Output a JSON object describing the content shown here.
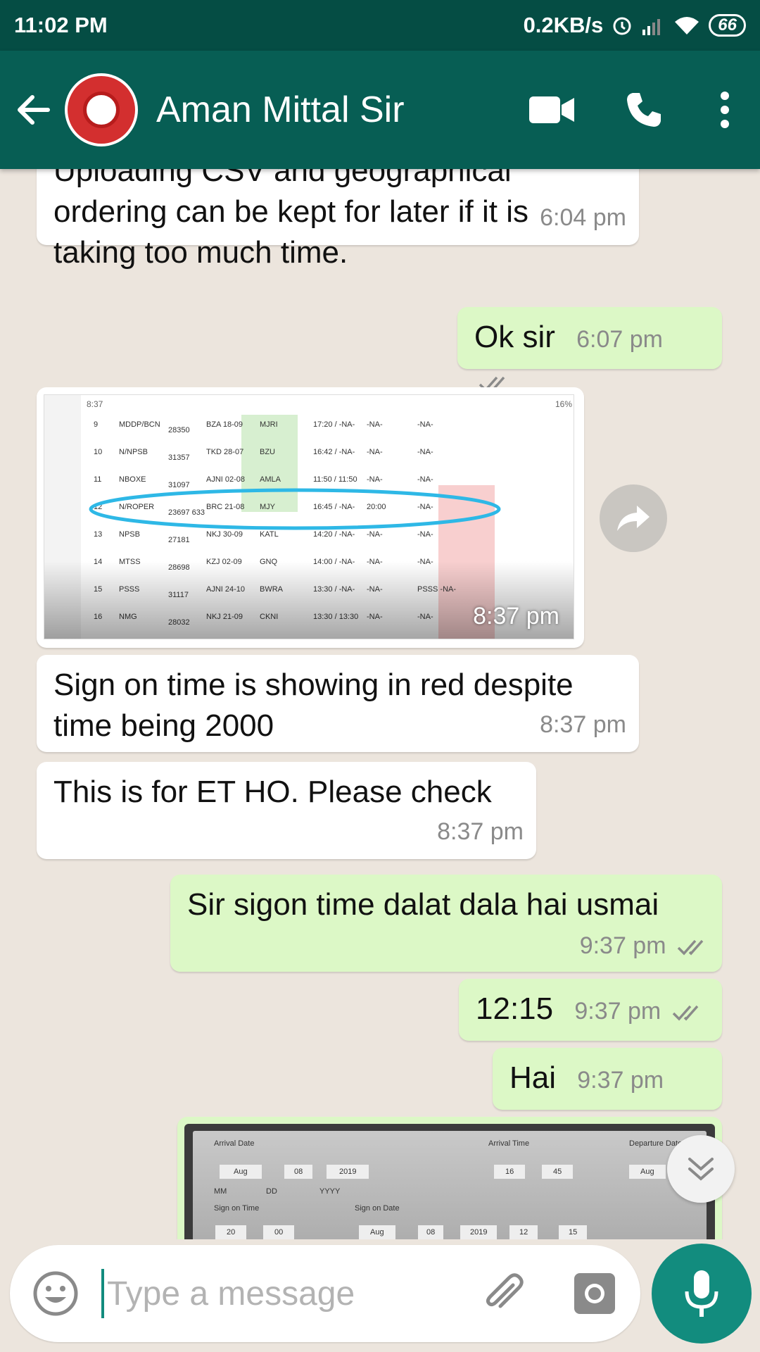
{
  "status_bar": {
    "time": "11:02 PM",
    "speed": "0.2KB/s",
    "battery": "66"
  },
  "app_bar": {
    "contact_name": "Aman Mittal Sir",
    "icons": [
      "back-arrow-icon",
      "video-call-icon",
      "voice-call-icon",
      "more-vert-icon"
    ]
  },
  "messages": [
    {
      "dir": "in",
      "text": "Uploading CSV and geographical ordering can be kept for later if it is taking too much time.",
      "time": "6:04 pm"
    },
    {
      "dir": "out",
      "text": "Ok sir",
      "time": "6:07 pm"
    },
    {
      "dir": "in",
      "type": "image",
      "time": "8:37 pm"
    },
    {
      "dir": "in",
      "text": "Sign on time is showing in red despite time being 2000",
      "time": "8:37 pm"
    },
    {
      "dir": "in",
      "text": "This is for ET HO. Please check",
      "time": "8:37 pm"
    },
    {
      "dir": "out",
      "text": "Sir sigon time dalat dala hai usmai",
      "time": "9:37 pm"
    },
    {
      "dir": "out",
      "text": "12:15",
      "time": "9:37 pm"
    },
    {
      "dir": "out",
      "text": "Hai",
      "time": "9:37 pm"
    },
    {
      "dir": "out",
      "type": "image"
    }
  ],
  "shared_image_1": {
    "status_time": "8:37",
    "battery": "16%",
    "rows": [
      [
        "9",
        "MDDP/BCN",
        "28350",
        "BZA 18-09",
        "MJRI",
        "17:20 / -NA-",
        "-NA-",
        "-NA-"
      ],
      [
        "10",
        "N/NPSB",
        "31357",
        "TKD 28-07",
        "BZU",
        "16:42 / -NA-",
        "-NA-",
        "-NA-"
      ],
      [
        "11",
        "NBOXE",
        "31097",
        "AJNI 02-08",
        "AMLA",
        "11:50 / 11:50",
        "-NA-",
        "-NA-"
      ],
      [
        "12",
        "N/ROPER",
        "23697 633",
        "BRC 21-08",
        "MJY",
        "16:45 / -NA-",
        "20:00",
        "-NA-"
      ],
      [
        "13",
        "NPSB",
        "27181",
        "NKJ 30-09",
        "KATL",
        "14:20 / -NA-",
        "-NA-",
        "-NA-"
      ],
      [
        "14",
        "MTSS",
        "28698",
        "KZJ 02-09",
        "GNQ",
        "14:00 / -NA-",
        "-NA-",
        "-NA-"
      ],
      [
        "15",
        "PSSS",
        "31117",
        "AJNI 24-10",
        "BWRA",
        "13:30 / -NA-",
        "-NA-",
        "PSSS -NA-"
      ],
      [
        "16",
        "NMG",
        "28032",
        "NKJ 21-09",
        "CKNI",
        "13:30 / 13:30",
        "-NA-",
        "-NA-"
      ]
    ]
  },
  "shared_image_2": {
    "labels": {
      "arrival_date": "Arrival Date",
      "arrival_time": "Arrival Time",
      "departure_date": "Departure Date",
      "sign_on_time": "Sign on Time",
      "sign_on_date": "Sign on Date",
      "mm": "MM",
      "dd": "DD",
      "yyyy": "YYYY"
    },
    "values": {
      "arr_month": "Aug",
      "arr_day": "08",
      "arr_year": "2019",
      "arr_hour": "16",
      "arr_min": "45",
      "dep_month": "Aug",
      "son_hour": "20",
      "son_min": "00",
      "sod_month": "Aug",
      "sod_day": "08",
      "sod_year": "2019",
      "sod_hour": "12",
      "sod_min": "15"
    }
  },
  "composer": {
    "placeholder": "Type a message"
  },
  "colors": {
    "header": "#075E54",
    "status_bar": "#054D44",
    "outgoing": "#DCF8C6",
    "incoming": "#FFFFFF",
    "accent": "#128C7E"
  }
}
